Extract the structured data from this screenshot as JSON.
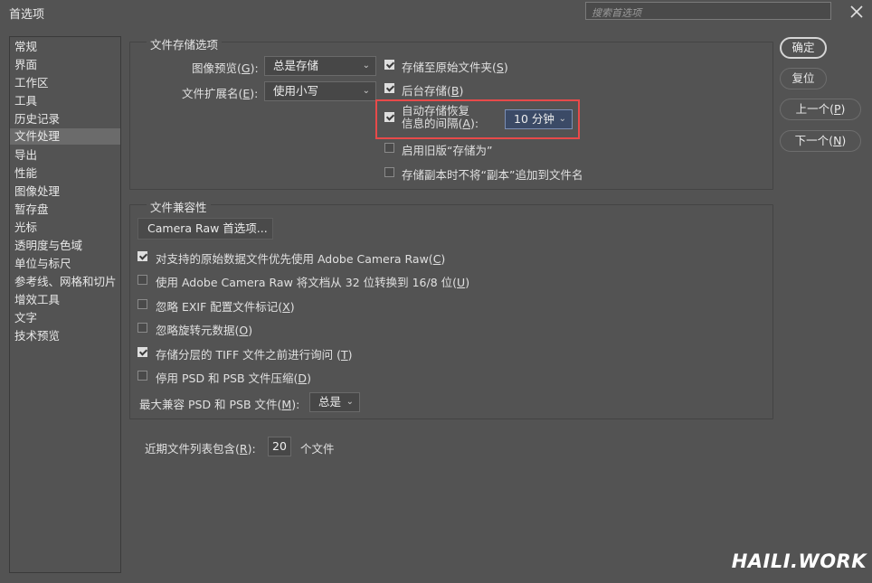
{
  "window": {
    "title": "首选项",
    "search_placeholder": "搜索首选项"
  },
  "sidebar": {
    "items": [
      "常规",
      "界面",
      "工作区",
      "工具",
      "历史记录",
      "文件处理",
      "导出",
      "性能",
      "图像处理",
      "暂存盘",
      "光标",
      "透明度与色域",
      "单位与标尺",
      "参考线、网格和切片",
      "增效工具",
      "文字",
      "技术预览"
    ],
    "selected": "文件处理"
  },
  "file_save": {
    "legend": "文件存储选项",
    "image_preview_label": "图像预览(",
    "image_preview_key": "G",
    "image_preview_value": "总是存储",
    "ext_label": "文件扩展名(",
    "ext_key": "E",
    "ext_value": "使用小写",
    "save_to_original": {
      "label": "存储至原始文件夹(",
      "key": "S",
      "checked": true
    },
    "background_save": {
      "label": "后台存储(",
      "key": "B",
      "checked": true
    },
    "auto_save": {
      "line1": "自动存储恢复",
      "line2": "信息的间隔(",
      "key": "A",
      "checked": true,
      "interval": "10 分钟"
    },
    "legacy_save_as": {
      "label": "启用旧版“存储为”",
      "checked": false
    },
    "no_copy_suffix": {
      "label": "存储副本时不将“副本”追加到文件名",
      "checked": false
    }
  },
  "compat": {
    "legend": "文件兼容性",
    "camera_raw_button": "Camera Raw 首选项...",
    "items": [
      {
        "pre": "对支持的原始数据文件优先使用 Adobe Camera Raw(",
        "key": "C",
        "post": ")",
        "checked": true
      },
      {
        "pre": "使用 Adobe Camera Raw 将文档从 32 位转换到 16/8 位(",
        "key": "U",
        "post": ")",
        "checked": false
      },
      {
        "pre": "忽略 EXIF 配置文件标记(",
        "key": "X",
        "post": ")",
        "checked": false
      },
      {
        "pre": "忽略旋转元数据(",
        "key": "O",
        "post": ")",
        "checked": false
      },
      {
        "pre": "存储分层的 TIFF 文件之前进行询问 (",
        "key": "T",
        "post": ")",
        "checked": true
      },
      {
        "pre": "停用 PSD 和 PSB 文件压缩(",
        "key": "D",
        "post": ")",
        "checked": false
      }
    ],
    "max_compat_label": "最大兼容 PSD 和 PSB 文件(",
    "max_compat_key": "M",
    "max_compat_value": "总是"
  },
  "recent": {
    "label": "近期文件列表包含(",
    "key": "R",
    "value": "20",
    "suffix": "个文件"
  },
  "buttons": {
    "ok": "确定",
    "reset": "复位",
    "prev": {
      "text": "上一个(",
      "key": "P"
    },
    "next": {
      "text": "下一个(",
      "key": "N"
    }
  },
  "watermark": "HAILI.WORK",
  "colors": {
    "background": "#535353",
    "highlight": "#e84a4a",
    "accent_select": "#3b4a66"
  }
}
